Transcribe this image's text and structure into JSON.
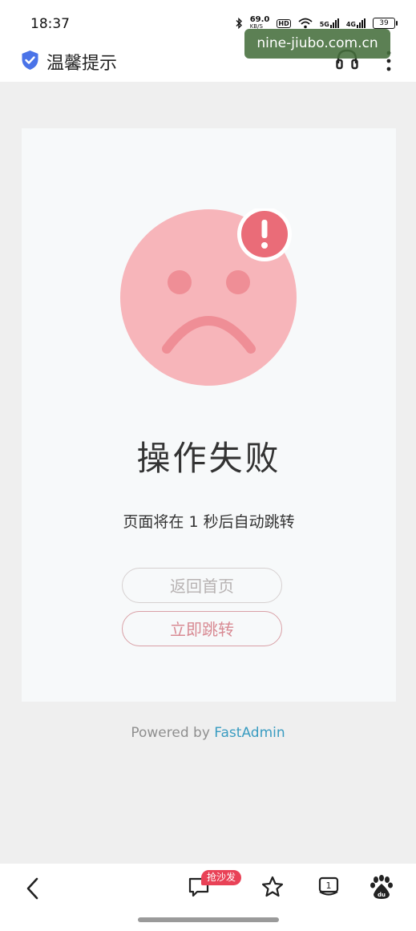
{
  "status_bar": {
    "time": "18:37",
    "net_speed": "69.0",
    "net_speed_unit": "KB/S",
    "hd_label": "HD",
    "signal1_label": "5G",
    "signal2_label": "4G",
    "battery": "39"
  },
  "watermark": "nine-jiubo.com.cn",
  "header": {
    "title": "温馨提示",
    "icons": [
      "shield-check-icon",
      "headset-icon",
      "more-vertical-icon"
    ]
  },
  "error": {
    "title": "操作失败",
    "countdown_text": "页面将在 1 秒后自动跳转",
    "buttons": {
      "home": "返回首页",
      "jump": "立即跳转"
    }
  },
  "footer": {
    "powered_prefix": "Powered by ",
    "powered_brand": "FastAdmin"
  },
  "bottom_nav": {
    "sofa_badge": "抢沙发",
    "tabs_count": "1",
    "icons": [
      "back-icon",
      "comment-icon",
      "star-icon",
      "tabs-icon",
      "baidu-icon"
    ]
  },
  "colors": {
    "face": "#f7b5ba",
    "face_features": "#ef8e96",
    "alert": "#ea6c78",
    "link": "#3a9cc1",
    "badge": "#e94257"
  }
}
